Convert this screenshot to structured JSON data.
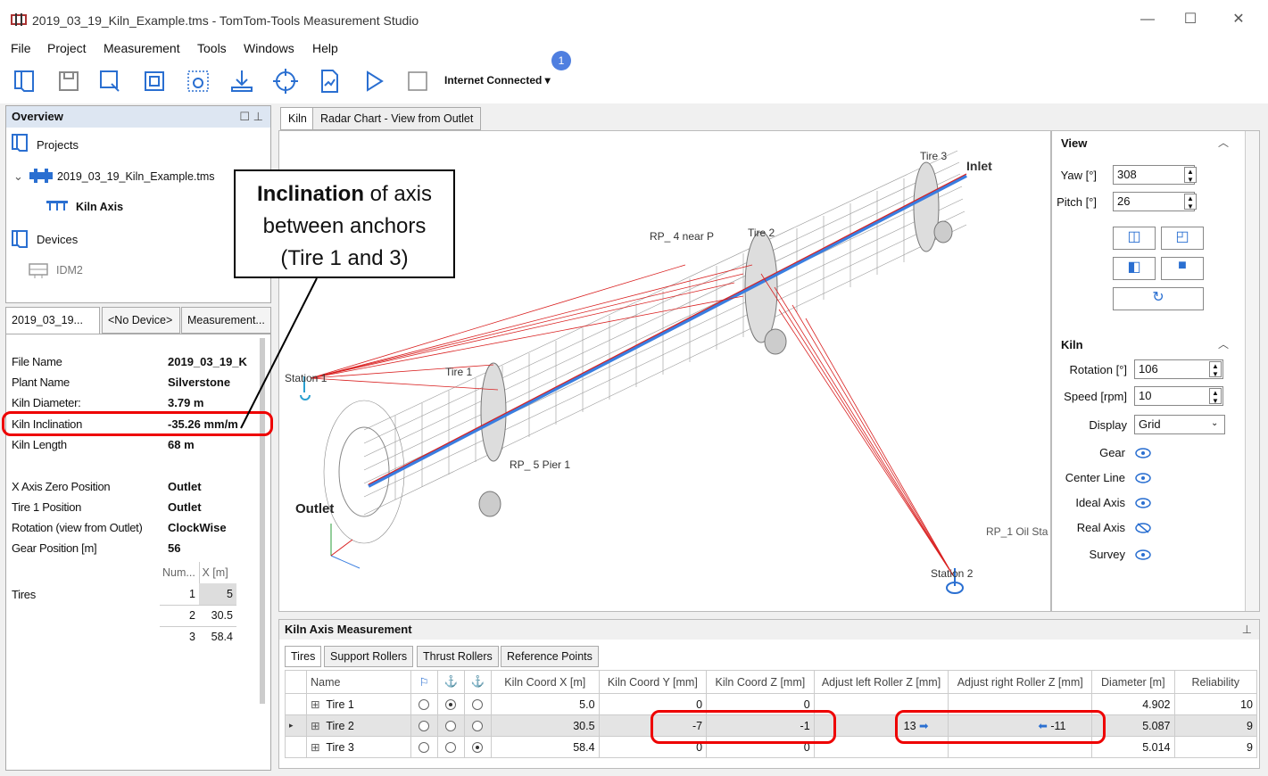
{
  "window": {
    "title": "2019_03_19_Kiln_Example.tms - TomTom-Tools Measurement Studio"
  },
  "menu": [
    "File",
    "Project",
    "Measurement",
    "Tools",
    "Windows",
    "Help"
  ],
  "toolbar": {
    "internet": "Internet Connected ▾",
    "badge": "1"
  },
  "overview": {
    "title": "Overview",
    "projects": "Projects",
    "file": "2019_03_19_Kiln_Example.tms",
    "kiln_axis": "Kiln Axis",
    "devices": "Devices",
    "device": "IDM2"
  },
  "left_tabs": [
    "2019_03_19...",
    "<No Device>",
    "Measurement..."
  ],
  "props": [
    {
      "label": "File Name",
      "value": "2019_03_19_K"
    },
    {
      "label": "Plant Name",
      "value": "Silverstone"
    },
    {
      "label": "Kiln Diameter:",
      "value": "3.79 m"
    },
    {
      "label": "Kiln Inclination",
      "value": "-35.26 mm/m"
    },
    {
      "label": "Kiln Length",
      "value": "68 m"
    },
    {
      "label": "X Axis Zero Position",
      "value": "Outlet"
    },
    {
      "label": "Tire 1 Position",
      "value": "Outlet"
    },
    {
      "label": "Rotation (view from Outlet)",
      "value": "ClockWise"
    },
    {
      "label": "Gear Position [m]",
      "value": "56"
    }
  ],
  "tires_table": {
    "label": "Tires",
    "headers": [
      "Num...",
      "X [m]"
    ],
    "rows": [
      [
        "1",
        "5"
      ],
      [
        "2",
        "30.5"
      ],
      [
        "3",
        "58.4"
      ]
    ]
  },
  "view_tabs": [
    "Kiln",
    "Radar Chart - View from Outlet"
  ],
  "scene": {
    "labels": [
      "Tire 3",
      "Inlet",
      "Tire 2",
      "RP_ 4 near P",
      "Tire 1",
      "Station 1",
      "Outlet",
      "RP_ 5 Pier 1",
      "RP_1 Oil Sta",
      "Station 2"
    ]
  },
  "callout": {
    "bold": "Inclination",
    "rest": " of axis",
    "line2": "between anchors",
    "line3": "(Tire 1 and 3)"
  },
  "view_panel": {
    "title": "View",
    "yaw_label": "Yaw [°]",
    "yaw": "308",
    "pitch_label": "Pitch [°]",
    "pitch": "26"
  },
  "kiln_panel": {
    "title": "Kiln",
    "rotation_label": "Rotation [°]",
    "rotation": "106",
    "speed_label": "Speed [rpm]",
    "speed": "10",
    "display_label": "Display",
    "display": "Grid",
    "toggles": [
      "Gear",
      "Center Line",
      "Ideal Axis",
      "Real Axis",
      "Survey"
    ]
  },
  "measurement": {
    "title": "Kiln Axis Measurement",
    "tabs": [
      "Tires",
      "Support Rollers",
      "Thrust Rollers",
      "Reference Points"
    ],
    "headers": [
      "Name",
      "Kiln Coord X [m]",
      "Kiln Coord Y [mm]",
      "Kiln Coord Z [mm]",
      "Adjust left Roller Z [mm]",
      "Adjust right Roller Z [mm]",
      "Diameter [m]",
      "Reliability"
    ],
    "rows": [
      {
        "name": "Tire 1",
        "x": "5.0",
        "y": "0",
        "z": "0",
        "left": "",
        "right": "",
        "dia": "4.902",
        "rel": "10",
        "sel": 1
      },
      {
        "name": "Tire 2",
        "x": "30.5",
        "y": "-7",
        "z": "-1",
        "left": "13",
        "right": "-11",
        "dia": "5.087",
        "rel": "9",
        "sel": -1
      },
      {
        "name": "Tire 3",
        "x": "58.4",
        "y": "0",
        "z": "0",
        "left": "",
        "right": "",
        "dia": "5.014",
        "rel": "9",
        "sel": 2
      }
    ]
  },
  "colors": {
    "accent": "#2a6fd1",
    "highlight": "#e00000",
    "axis_red": "#d92020",
    "axis_blue": "#3a7ee0"
  }
}
